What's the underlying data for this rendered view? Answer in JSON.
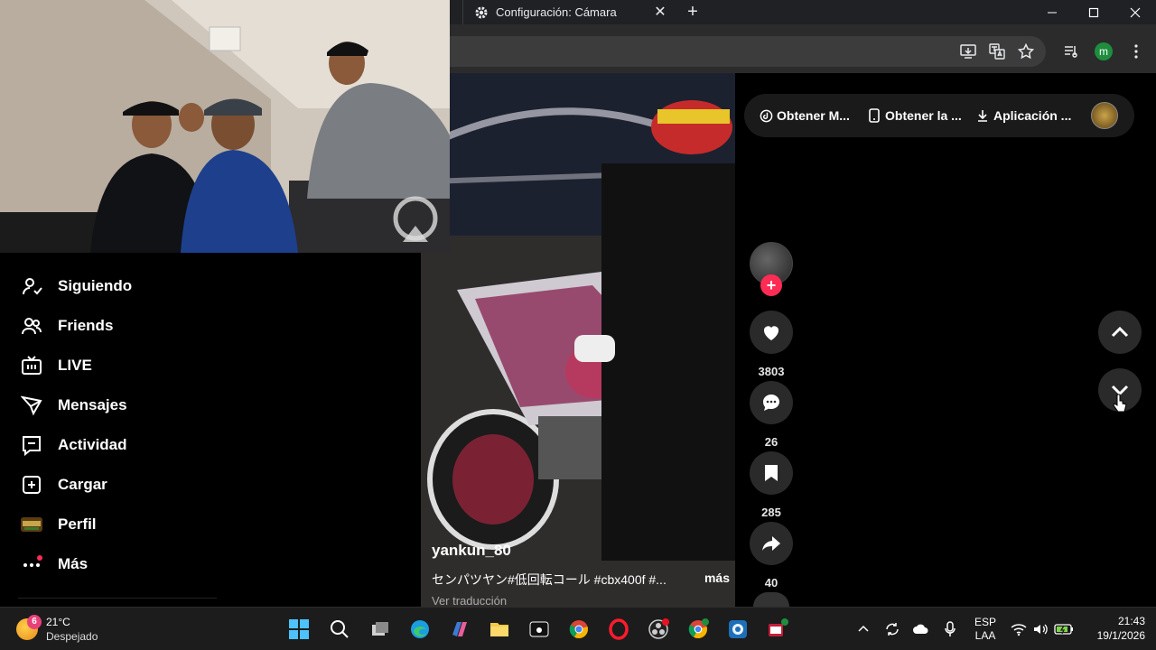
{
  "browser": {
    "tab_title": "Configuración: Cámara",
    "tab_close": "✕",
    "new_tab": "+",
    "window_controls": {
      "minimize": "—",
      "maximize": "☐",
      "close": "✕"
    },
    "profile_initial": "m"
  },
  "sidebar": {
    "items": [
      {
        "label": "Siguiendo",
        "icon": "following-icon"
      },
      {
        "label": "Friends",
        "icon": "friends-icon"
      },
      {
        "label": "LIVE",
        "icon": "live-icon"
      },
      {
        "label": "Mensajes",
        "icon": "messages-icon"
      },
      {
        "label": "Actividad",
        "icon": "activity-icon"
      },
      {
        "label": "Cargar",
        "icon": "upload-icon"
      },
      {
        "label": "Perfil",
        "icon": "profile-avatar"
      },
      {
        "label": "Más",
        "icon": "more-icon"
      }
    ]
  },
  "topbar": {
    "buttons": [
      {
        "label": "Obtener M...",
        "icon": "coin-icon"
      },
      {
        "label": "Obtener la ...",
        "icon": "phone-icon"
      },
      {
        "label": "Aplicación ...",
        "icon": "download-icon"
      }
    ]
  },
  "video": {
    "author": "yankun_80",
    "caption": "センパツヤン#低回転コール #cbx400f #...",
    "more": "más",
    "translate": "Ver traducción"
  },
  "actions": {
    "likes": "3803",
    "comments": "26",
    "saves": "285",
    "shares": "40"
  },
  "taskbar": {
    "weather_badge": "6",
    "temperature": "21°C",
    "condition": "Despejado",
    "language_top": "ESP",
    "language_bottom": "LAA",
    "time": "21:43",
    "date": "19/1/2026"
  }
}
